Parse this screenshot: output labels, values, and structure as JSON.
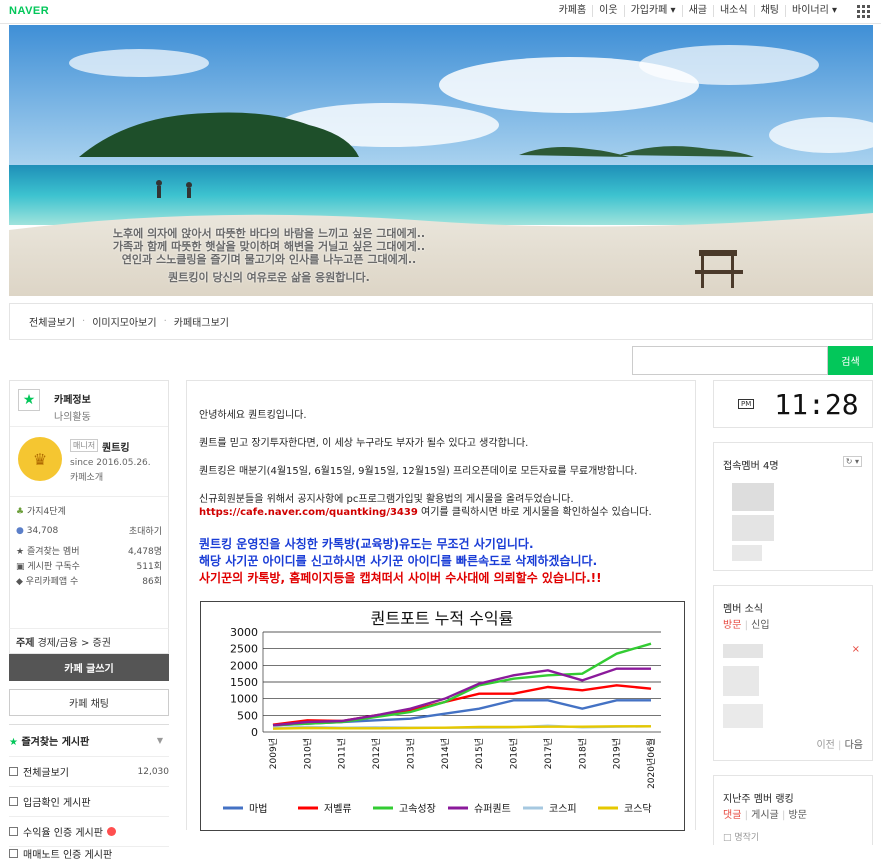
{
  "topbar": {
    "logo": "NAVER",
    "nav": [
      "카페홈",
      "이웃",
      "가입카페 ▾",
      "새글",
      "내소식",
      "채팅",
      "바이너리 ▾"
    ]
  },
  "banner": {
    "lines": [
      "노후에 의자에 앉아서 따뜻한 바다의 바람을 느끼고 싶은 그대에게..",
      "가족과 함께 따뜻한 햇살을 맞이하며 해변을 거닐고 싶은 그대에게..",
      "연인과 스노클링을 즐기며 물고기와 인사를 나누고픈 그대에게..",
      "퀀트킹이 당신의 여유로운 삶을 응원합니다."
    ]
  },
  "menu": [
    "전체글보기",
    "이미지모아보기",
    "카페태그보기"
  ],
  "search": {
    "button": "검색"
  },
  "sidebar": {
    "tab_info": "카페정보",
    "tab_activity": "나의활동",
    "manager_badge": "매니저",
    "manager_name": "퀀트킹",
    "since": "since 2016.05.26.",
    "intro": "카페소개",
    "level": "가지4단계",
    "members": "34,708",
    "invite": "초대하기",
    "stats": [
      {
        "label": "즐겨찾는 멤버",
        "value": "4,478명"
      },
      {
        "label": "게시판 구독수",
        "value": "511회"
      },
      {
        "label": "우리카페앱 수",
        "value": "86회"
      }
    ],
    "topic_label": "주제",
    "topic_value": "경제/금융 > 증권",
    "write_button": "카페 글쓰기",
    "chat_button": "카페 채팅",
    "fav_boards": "즐겨찾는 게시판",
    "boards": [
      {
        "label": "전체글보기",
        "count": "12,030"
      },
      {
        "label": "입금확인 게시판",
        "count": ""
      },
      {
        "label": "수익율 인증 게시판",
        "count": ""
      },
      {
        "label": "매매노트 인증 게시판",
        "count": ""
      }
    ]
  },
  "post": {
    "p1": "안녕하세요 퀀트킹입니다.",
    "p2": "퀀트를 믿고 장기투자한다면, 이 세상 누구라도 부자가 될수 있다고 생각합니다.",
    "p3": "퀀트킹은 매분기(4월15일, 6월15일, 9월15일, 12월15일) 프리오픈데이로 모든자료를 무료개방합니다.",
    "p4": "신규회원분들을 위해서 공지사항에 pc프로그램가입및 활용법의 게시물을 올려두었습니다.",
    "link": "https://cafe.naver.com/quantking/3439",
    "link_after": " 여기를 클릭하시면 바로 게시물을 확인하실수 있습니다.",
    "warn1": "퀀트킹 운영진을 사칭한 카톡방(교육방)유도는 무조건 사기입니다.",
    "warn2": "해당 사기꾼 아이디를 신고하시면 사기꾼 아이디를 빠른속도로 삭제하겠습니다.",
    "warn3": "사기꾼의 카톡방, 홈페이지등을 캡쳐떠서 사이버 수사대에 의뢰할수 있습니다.!!"
  },
  "chart_data": {
    "type": "line",
    "title": "퀀트포트 누적 수익률",
    "categories": [
      "2009년",
      "2010년",
      "2011년",
      "2012년",
      "2013년",
      "2014년",
      "2015년",
      "2016년",
      "2017년",
      "2018년",
      "2019년",
      "2020년06월"
    ],
    "ylim": [
      0,
      3000
    ],
    "yticks": [
      "0",
      "500",
      "1000",
      "1500",
      "2000",
      "2500",
      "3000"
    ],
    "series": [
      {
        "name": "마법",
        "color": "#4472c4",
        "values": [
          200,
          250,
          300,
          350,
          400,
          550,
          700,
          950,
          950,
          700,
          950,
          950
        ]
      },
      {
        "name": "저벨류",
        "color": "#ff0000",
        "values": [
          220,
          350,
          330,
          500,
          650,
          900,
          1150,
          1150,
          1350,
          1250,
          1400,
          1300
        ]
      },
      {
        "name": "고속성장",
        "color": "#33cc33",
        "values": [
          200,
          250,
          300,
          450,
          600,
          900,
          1400,
          1600,
          1700,
          1750,
          2350,
          2650
        ]
      },
      {
        "name": "슈퍼퀀트",
        "color": "#8b1a9b",
        "values": [
          200,
          300,
          330,
          500,
          700,
          1000,
          1450,
          1700,
          1850,
          1550,
          1900,
          1900
        ]
      },
      {
        "name": "코스피",
        "color": "#a6c8e0",
        "values": [
          120,
          150,
          130,
          140,
          130,
          130,
          130,
          140,
          190,
          140,
          160,
          170
        ]
      },
      {
        "name": "코스닥",
        "color": "#e6c800",
        "values": [
          100,
          120,
          110,
          110,
          120,
          130,
          150,
          150,
          160,
          160,
          170,
          170
        ]
      }
    ]
  },
  "right": {
    "clock_tag": "PM",
    "time": "11:28",
    "online_members": "접속멤버 4명",
    "news_title": "멤버 소식",
    "news_tab1": "방문",
    "news_tab2": "신입",
    "prev": "이전",
    "next": "다음",
    "ranking_title": "지난주 멤버 랭킹",
    "rank_tab1": "댓글",
    "rank_tab2": "게시글",
    "rank_tab3": "방문",
    "bottom_cut": "□ 명작기"
  },
  "colors": {
    "brand": "#03c75a",
    "dark_button": "#555555"
  }
}
